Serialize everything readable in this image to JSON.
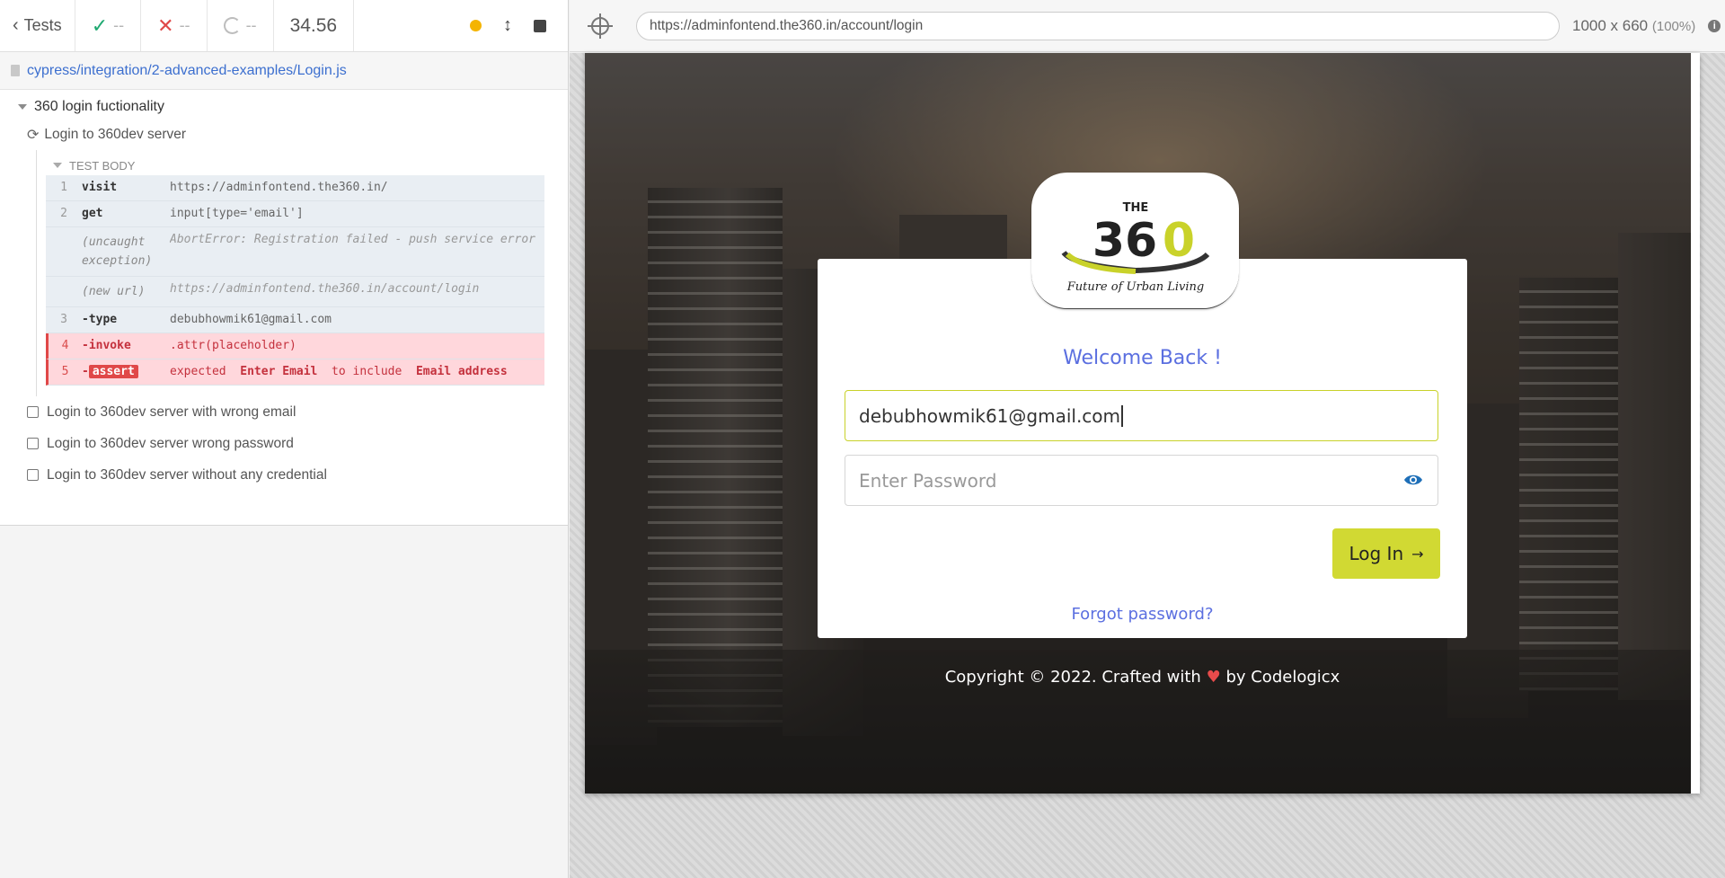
{
  "stats": {
    "tests_label": "Tests",
    "passed": "--",
    "failed": "--",
    "pending": "--",
    "duration": "34.56"
  },
  "spec": {
    "path": "cypress/integration/2-advanced-examples/Login.js"
  },
  "suite": {
    "title": "360 login fuctionality",
    "running_test": "Login to 360dev server",
    "test_body_label": "TEST BODY",
    "commands": [
      {
        "num": "1",
        "name": "visit",
        "msg": "https://adminfontend.the360.in/"
      },
      {
        "num": "2",
        "name": "get",
        "msg": "input[type='email']"
      },
      {
        "num": "",
        "name": "(uncaught exception)",
        "msg": "AbortError: Registration failed - push service error"
      },
      {
        "num": "",
        "name": "(new url)",
        "msg": "https://adminfontend.the360.in/account/login"
      },
      {
        "num": "3",
        "name": "-type",
        "msg": "debubhowmik61@gmail.com"
      },
      {
        "num": "4",
        "name": "-invoke",
        "msg": ".attr(placeholder)"
      },
      {
        "num": "5",
        "name": "assert",
        "msg_parts": [
          "expected",
          "Enter Email",
          "to include",
          "Email address"
        ]
      }
    ],
    "other_tests": [
      "Login to 360dev server with wrong email",
      "Login to 360dev server wrong password",
      "Login to 360dev server without any credential"
    ]
  },
  "aut": {
    "url": "https://adminfontend.the360.in/account/login",
    "viewport": "1000 x 660",
    "zoom": "(100%)"
  },
  "login": {
    "logo_top": "THE",
    "logo_number_a": "36",
    "logo_number_b": "0",
    "logo_tagline": "Future of Urban Living",
    "welcome": "Welcome Back !",
    "email_value": "debubhowmik61@gmail.com",
    "password_placeholder": "Enter Password",
    "login_label": "Log In",
    "forgot": "Forgot password?",
    "copyright_pre": "Copyright © 2022. Crafted with",
    "copyright_post": "by Codelogicx"
  },
  "colors": {
    "accent": "#5b6fe0",
    "button": "#d1d933",
    "pass": "#1fa971",
    "fail": "#e04848"
  },
  "icons": [
    "chevron-left-icon",
    "check-icon",
    "x-icon",
    "spinner-icon",
    "status-dot-icon",
    "scroll-toggle-icon",
    "stop-icon",
    "file-icon",
    "caret-down-icon",
    "refresh-icon",
    "checkbox-icon",
    "crosshair-icon",
    "info-icon",
    "eye-icon",
    "arrow-right-icon",
    "heart-icon"
  ]
}
